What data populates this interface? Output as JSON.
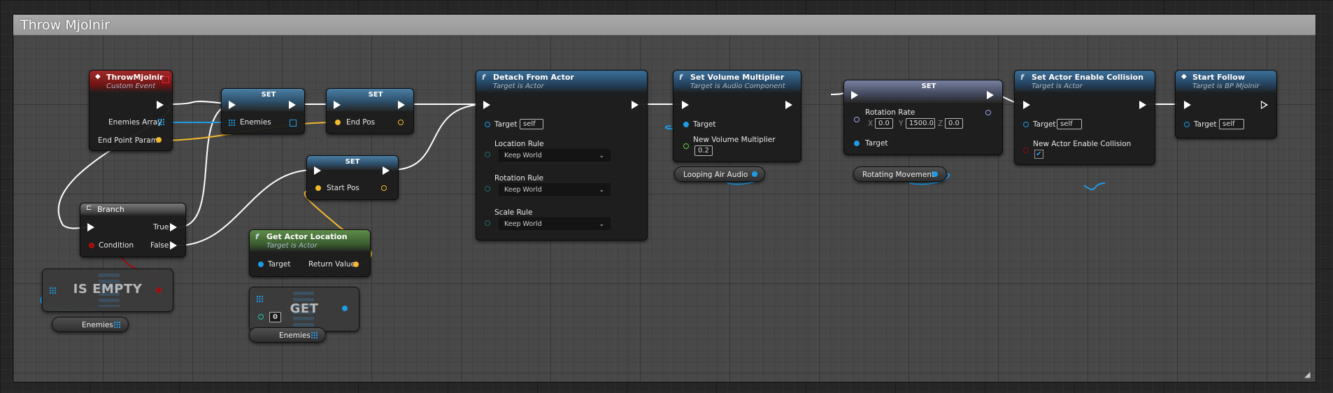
{
  "comment": {
    "title": "Throw Mjolnir"
  },
  "nodes": {
    "throw_event": {
      "title": "ThrowMjolnir",
      "subtitle": "Custom Event",
      "pin_enemies": "Enemies Array",
      "pin_end_point": "End Point Param"
    },
    "set_enemies": {
      "title": "SET",
      "pin": "Enemies"
    },
    "set_end_pos": {
      "title": "SET",
      "pin": "End Pos"
    },
    "set_start_pos": {
      "title": "SET",
      "pin": "Start Pos"
    },
    "branch": {
      "title": "Branch",
      "pin_true": "True",
      "pin_false": "False",
      "pin_condition": "Condition"
    },
    "is_empty": {
      "title": "IS EMPTY"
    },
    "get_actor_location": {
      "title": "Get Actor Location",
      "subtitle": "Target is Actor",
      "pin_target": "Target",
      "pin_return": "Return Value"
    },
    "get_array": {
      "title": "GET",
      "index": "0"
    },
    "detach": {
      "title": "Detach From Actor",
      "subtitle": "Target is Actor",
      "pin_target": "Target",
      "target_value": "self",
      "location_rule": "Location Rule",
      "location_value": "Keep World",
      "rotation_rule": "Rotation Rule",
      "rotation_value": "Keep World",
      "scale_rule": "Scale Rule",
      "scale_value": "Keep World"
    },
    "set_volume": {
      "title": "Set Volume Multiplier",
      "subtitle": "Target is Audio Component",
      "pin_target": "Target",
      "pin_mult": "New Volume Multiplier",
      "mult_value": "0.2"
    },
    "set_rotation": {
      "title": "SET",
      "pin_rate": "Rotation Rate",
      "x_label": "X",
      "x": "0.0",
      "y_label": "Y",
      "y": "1500.0",
      "z_label": "Z",
      "z": "0.0",
      "pin_target": "Target"
    },
    "set_collision": {
      "title": "Set Actor Enable Collision",
      "subtitle": "Target is Actor",
      "pin_target": "Target",
      "target_value": "self",
      "pin_enable": "New Actor Enable Collision",
      "checked": "✔"
    },
    "start_follow": {
      "title": "Start Follow",
      "subtitle": "Target is BP Mjolnir",
      "pin_target": "Target",
      "target_value": "self"
    }
  },
  "getters": {
    "enemies_1": "Enemies",
    "enemies_2": "Enemies",
    "looping_air_audio": "Looping Air Audio",
    "rotating_movement": "Rotating Movement"
  },
  "colors": {
    "exec": "#ffffff",
    "object": "#1f9be6",
    "vector": "#f5b92e",
    "bool": "#9b0d0d",
    "float": "#5fce39",
    "rotator": "#9aa6f3",
    "function_header": "#3b6f98",
    "event_header": "#a22a2a",
    "pure_header": "#5e8d4a"
  }
}
